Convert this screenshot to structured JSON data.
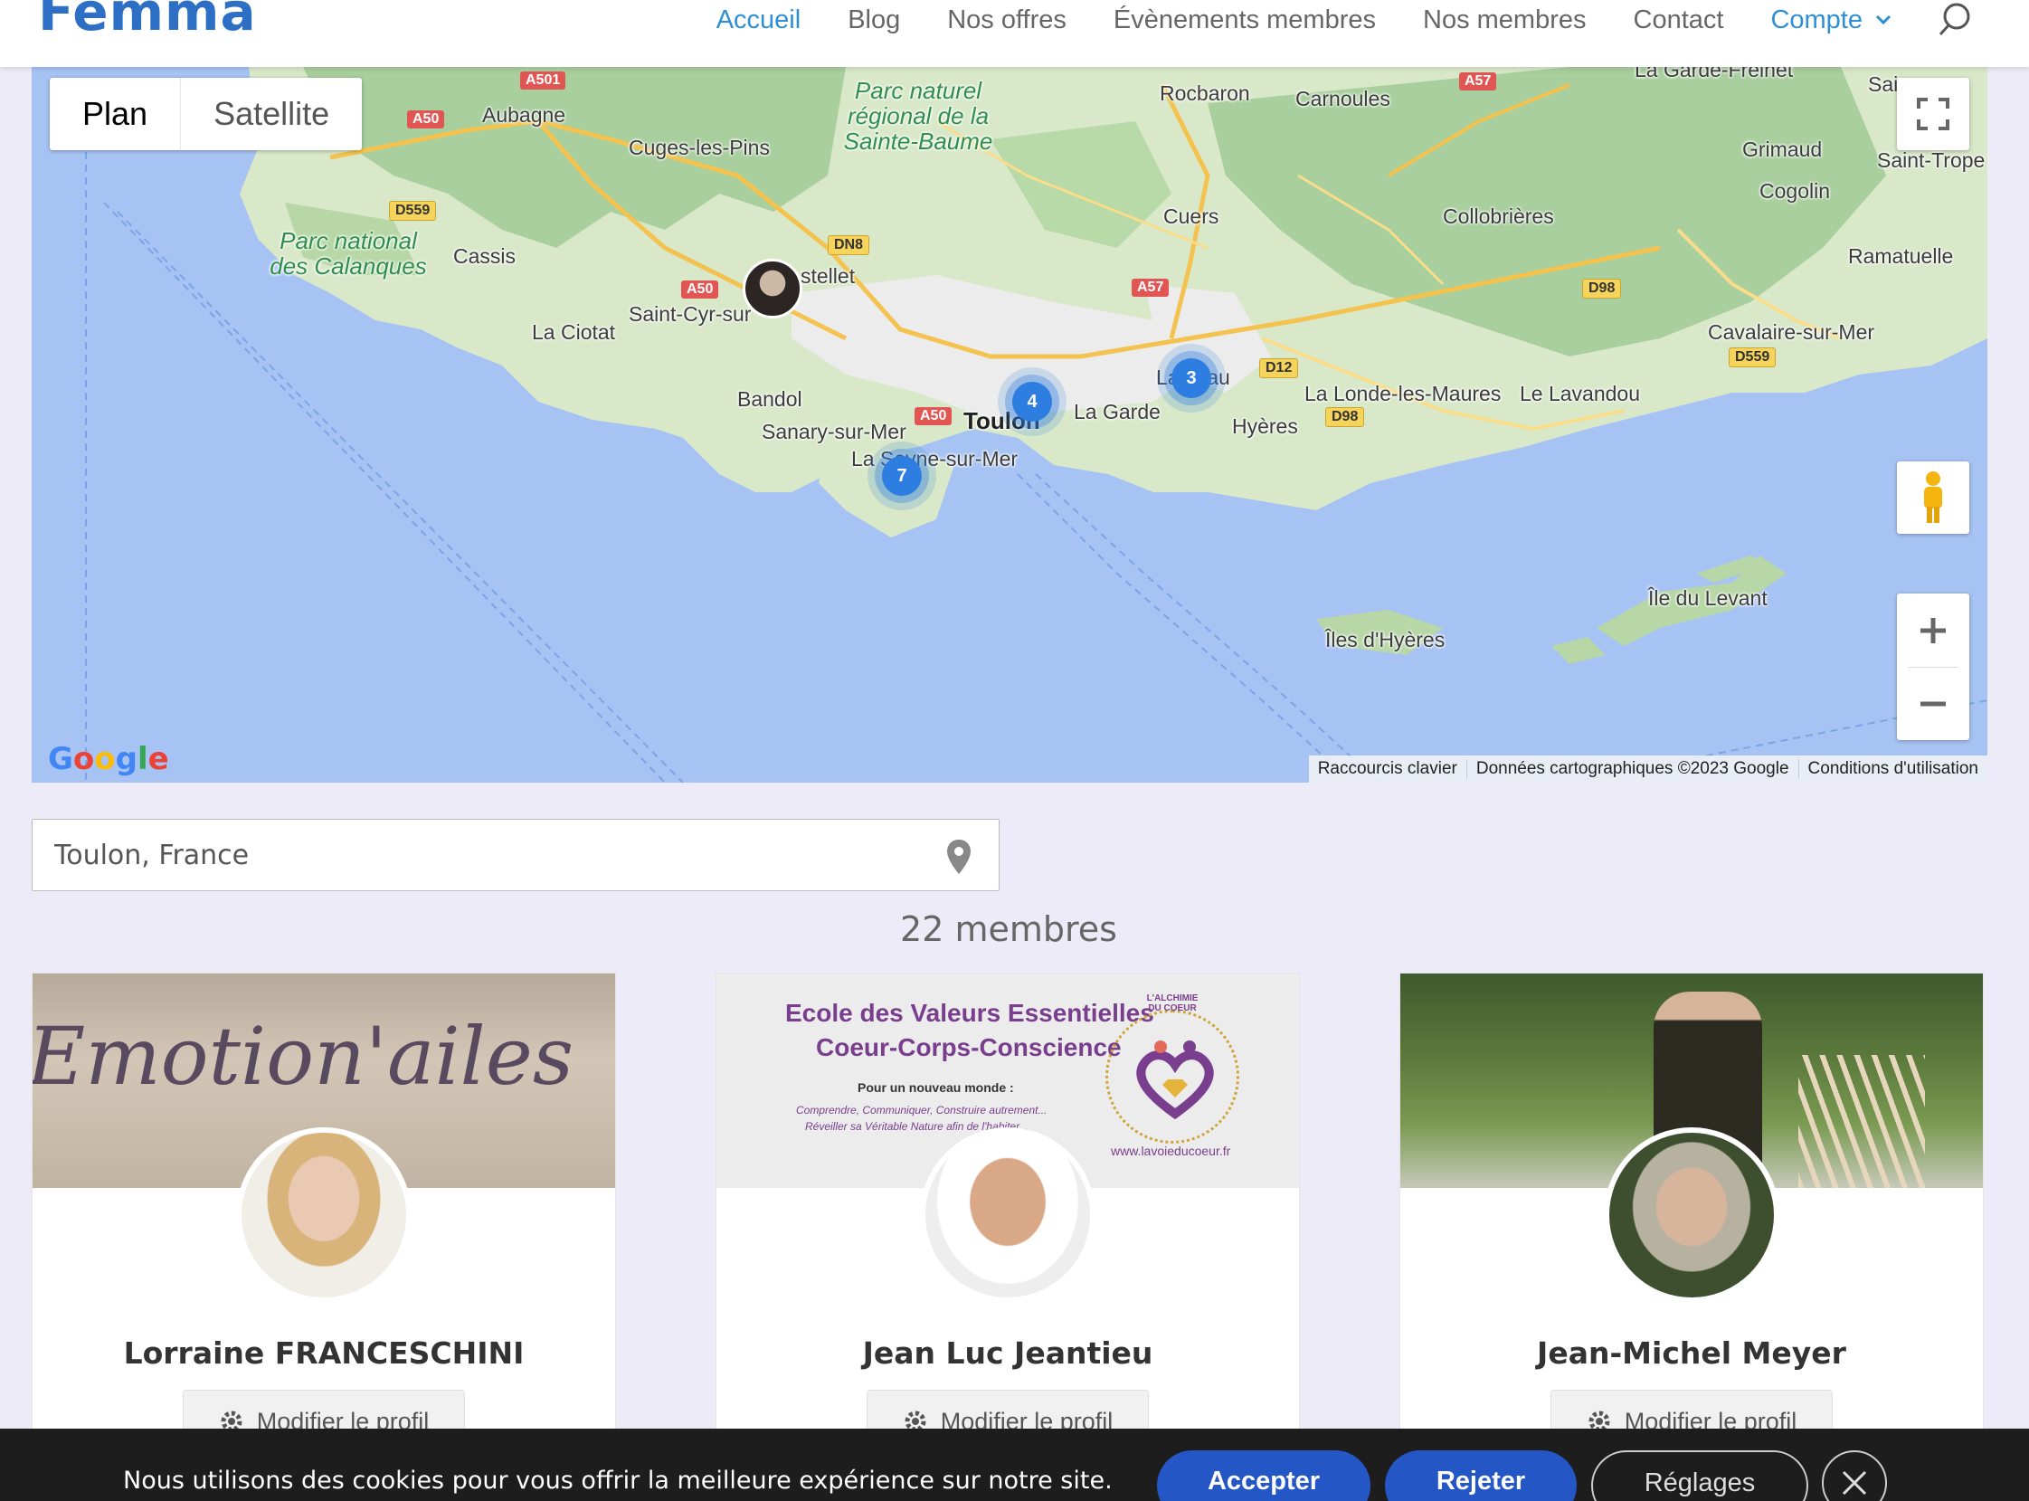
{
  "header": {
    "logo": "Femma",
    "nav": {
      "accueil": "Accueil",
      "blog": "Blog",
      "offres": "Nos offres",
      "evenements": "Évènements membres",
      "membres": "Nos membres",
      "contact": "Contact",
      "compte": "Compte"
    }
  },
  "map": {
    "type_plan": "Plan",
    "type_satellite": "Satellite",
    "attribution": {
      "shortcuts": "Raccourcis clavier",
      "data": "Données cartographiques ©2023 Google",
      "terms": "Conditions d'utilisation"
    },
    "places": {
      "aubagne": "Aubagne",
      "cuges": "Cuges-les-Pins",
      "park_sainte_baume": "Parc naturel régional de la Sainte-Baume",
      "rocbaron": "Rocbaron",
      "carnoules": "Carnoules",
      "garde_freinet": "La Garde-Freinet",
      "grimaud": "Grimaud",
      "saint_tropez": "Saint-Trope",
      "sainte_maxime": "Sai",
      "cogolin": "Cogolin",
      "ramatuelle": "Ramatuelle",
      "collobrieres": "Collobrières",
      "cuers": "Cuers",
      "calanques": "Parc national des Calanques",
      "cassis": "Cassis",
      "castellet": "stellet",
      "saint_cyr": "Saint-Cyr-sur",
      "la_ciotat": "La Ciotat",
      "bandol": "Bandol",
      "sanary": "Sanary-sur-Mer",
      "toulon": "Toulon",
      "la_garde": "La Garde",
      "la_seyne": "La Seyne-sur-Mer",
      "la_crau": "La Crau",
      "hyeres": "Hyères",
      "la_londe": "La Londe-les-Maures",
      "le_lavandou": "Le Lavandou",
      "cavalaire": "Cavalaire-sur-Mer",
      "ile_levant": "Île du Levant",
      "iles_hyeres": "Îles d'Hyères"
    },
    "roads": {
      "a501": "A501",
      "a50": "A50",
      "d559": "D559",
      "dn8": "DN8",
      "a57": "A57",
      "d98": "D98",
      "d12": "D12"
    },
    "clusters": {
      "toulon": "4",
      "la_crau": "3",
      "la_seyne": "7"
    }
  },
  "search": {
    "value": "Toulon, France"
  },
  "members_count": "22 membres",
  "members": [
    {
      "name": "Lorraine FRANCESCHINI",
      "cover_text": "Emotion'ailes",
      "edit_label": "Modifier le profil"
    },
    {
      "name": "Jean Luc Jeantieu",
      "cover_title_1": "Ecole des Valeurs Essentielles",
      "cover_title_2": "Coeur-Corps-Conscience",
      "cover_sub": "Pour un nouveau monde :",
      "cover_line_1": "Comprendre, Communiquer, Construire autrement...",
      "cover_line_2": "Réveiller sa Véritable Nature afin de l'habiter...",
      "cover_logo_text": "L'ALCHIMIE DU COEUR",
      "cover_url": "www.lavoieducoeur.fr",
      "edit_label": "Modifier le profil"
    },
    {
      "name": "Jean-Michel Meyer",
      "edit_label": "Modifier le profil"
    }
  ],
  "cookie": {
    "text": "Nous utilisons des cookies pour vous offrir la meilleure expérience sur notre site.",
    "accept": "Accepter",
    "reject": "Rejeter",
    "settings": "Réglages"
  }
}
